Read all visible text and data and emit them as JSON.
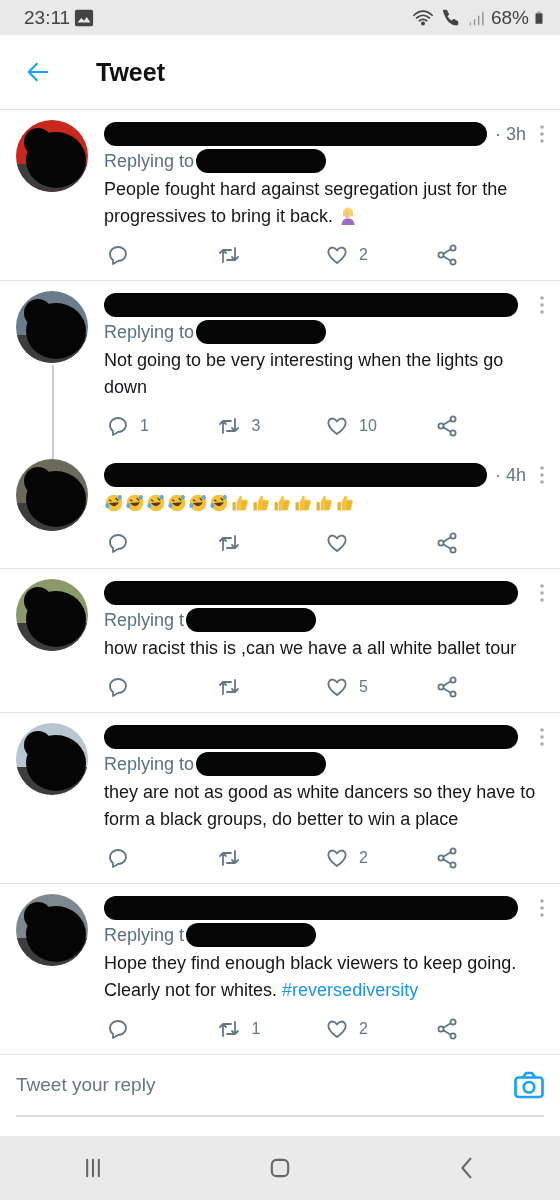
{
  "status_bar": {
    "time": "23:11",
    "battery": "68%"
  },
  "header": {
    "title": "Tweet"
  },
  "tweets": [
    {
      "time": "· 3h",
      "replying": "Replying to",
      "text": "People fought hard against segregation just for the progressives to bring it back.",
      "emojis": [
        {
          "kind": "facepalm"
        }
      ],
      "likes": "2",
      "connected_to_next": false
    },
    {
      "replying": "Replying to",
      "text": "Not going to be very interesting when the lights go down",
      "replies": "1",
      "retweets": "3",
      "likes": "10",
      "connected_to_next": true
    },
    {
      "time": "· 4h",
      "emojis": [
        {
          "kind": "laughing"
        },
        {
          "kind": "laughing"
        },
        {
          "kind": "laughing"
        },
        {
          "kind": "laughing"
        },
        {
          "kind": "laughing"
        },
        {
          "kind": "laughing"
        },
        {
          "kind": "thumbs-up"
        },
        {
          "kind": "thumbs-up"
        },
        {
          "kind": "thumbs-up"
        },
        {
          "kind": "thumbs-up"
        },
        {
          "kind": "thumbs-up"
        },
        {
          "kind": "thumbs-up"
        }
      ],
      "connected_to_next": false
    },
    {
      "replying": "Replying t",
      "text": "how racist this is ,can we have a all white ballet tour",
      "likes": "5",
      "connected_to_next": false
    },
    {
      "replying": "Replying to",
      "text": "they are not as good as white dancers so they have to form a black groups, do better to win a place",
      "likes": "2",
      "connected_to_next": false
    },
    {
      "replying": "Replying t",
      "text": "Hope they find enough black viewers to keep going. Clearly not for whites.",
      "hashtag": "#reversediversity",
      "retweets": "1",
      "likes": "2",
      "connected_to_next": false
    }
  ],
  "reply_box": {
    "placeholder": "Tweet your reply"
  }
}
